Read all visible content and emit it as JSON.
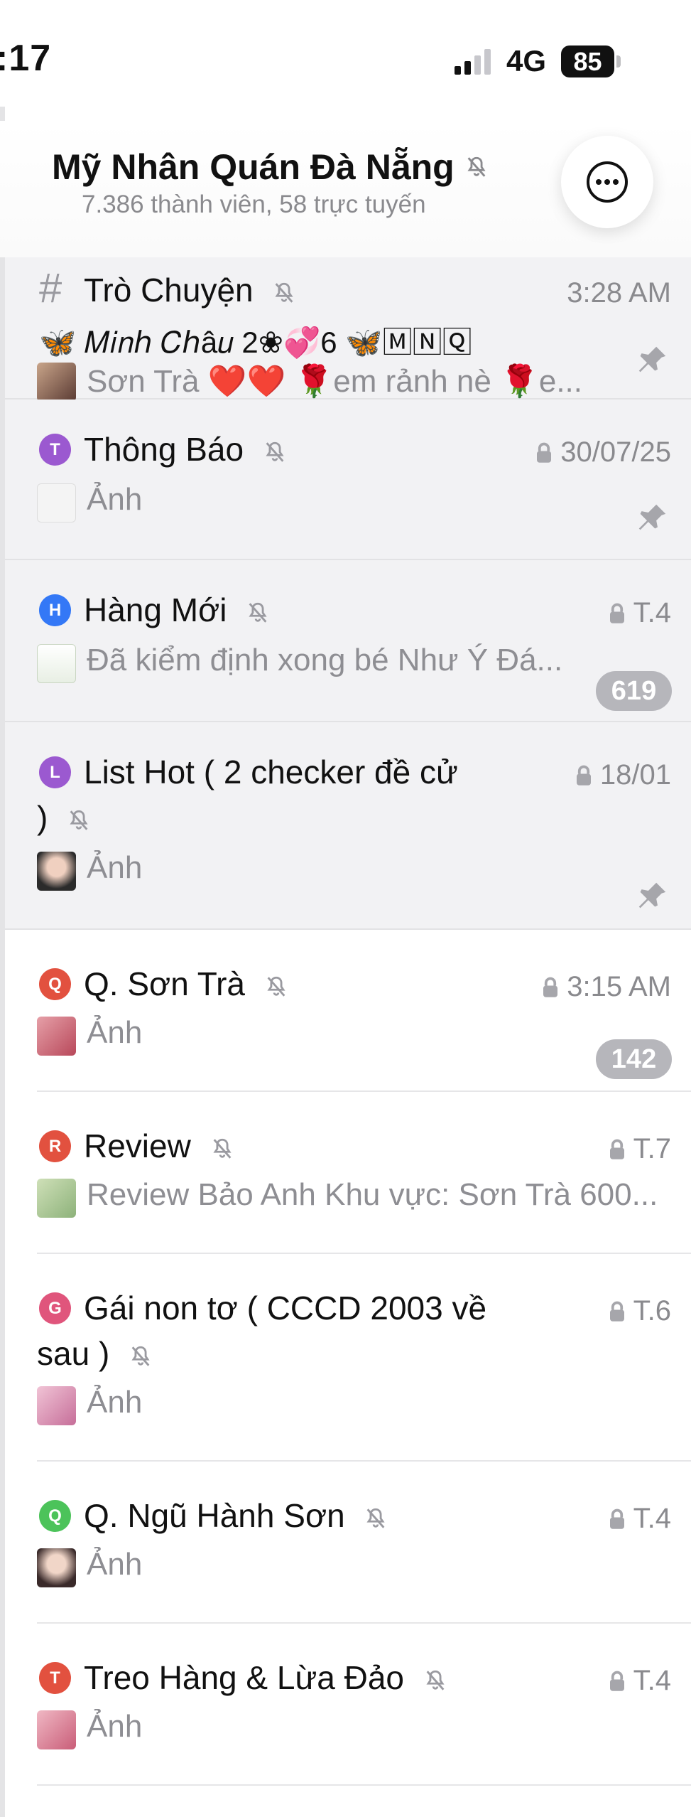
{
  "status_bar": {
    "time": ":17",
    "network": "4G",
    "battery": "85"
  },
  "header": {
    "title": "Mỹ Nhân Quán Đà Nẵng",
    "subtitle": "7.386 thành viên, 58 trực tuyến"
  },
  "topics": [
    {
      "name": "Trò Chuyện",
      "time": "3:28 AM",
      "sender": "🦋 𝑀𝑖𝑛ℎ 𝐶ℎâ𝑢 2❀💞6 🦋🄼🄽🅀",
      "preview": "Sơn Trà ❤️❤️ 🌹em rảnh nè 🌹e...",
      "pinned": true
    },
    {
      "name": "Thông Báo",
      "badge": "T",
      "time": "30/07/25",
      "preview": "Ảnh",
      "pinned": true
    },
    {
      "name": "Hàng Mới",
      "badge": "H",
      "time": "T.4",
      "preview": "Đã kiểm định xong bé Như Ý Đá...",
      "unread": "619",
      "pinned": true
    },
    {
      "name": "List Hot ( 2 checker đề cử",
      "name_cont": ")",
      "badge": "L",
      "time": "18/01",
      "preview": "Ảnh",
      "pinned": true
    },
    {
      "name": "Q. Sơn Trà",
      "badge": "Q",
      "time": "3:15 AM",
      "preview": "Ảnh",
      "unread": "142"
    },
    {
      "name": "Review",
      "badge": "R",
      "time": "T.7",
      "preview": "Review Bảo Anh Khu vực: Sơn Trà 600..."
    },
    {
      "name": "Gái non tơ ( CCCD 2003 về",
      "name_cont": "sau )",
      "badge": "G",
      "time": "T.6",
      "preview": "Ảnh"
    },
    {
      "name": "Q. Ngũ Hành Sơn",
      "badge": "Q",
      "time": "T.4",
      "preview": "Ảnh"
    },
    {
      "name": "Treo Hàng & Lừa Đảo",
      "badge": "T",
      "time": "T.4",
      "preview": "Ảnh"
    }
  ],
  "colors": {
    "purple_badge": "#9b59d0",
    "blue_badge": "#3478f6",
    "red_badge": "#e2513f",
    "pink_badge": "#e0557c",
    "green_badge": "#4cc35a",
    "unread_pill": "#b6b6bb"
  }
}
